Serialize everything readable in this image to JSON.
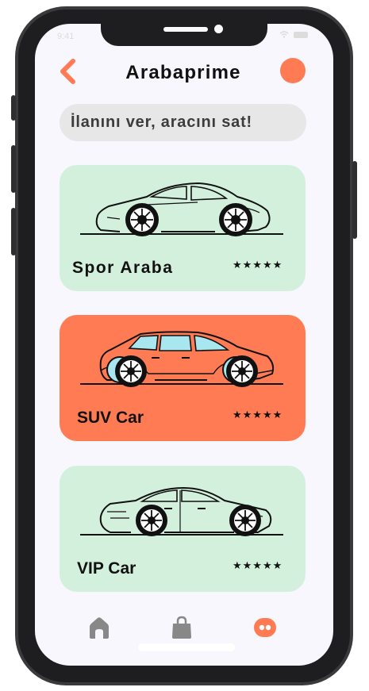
{
  "status_bar": {
    "time": "9:41"
  },
  "header": {
    "title": "Arabaprime"
  },
  "search": {
    "placeholder": "İlanını ver, aracını sat!"
  },
  "cards": [
    {
      "name": "Spor Araba",
      "rating": "★★★★★",
      "icon": "sports-car-icon",
      "color": "#d3f0dd"
    },
    {
      "name": "SUV Car",
      "rating": "★★★★★",
      "icon": "suv-car-icon",
      "color": "#ff7b54"
    },
    {
      "name": "VIP Car",
      "rating": "★★★★★",
      "icon": "sedan-car-icon",
      "color": "#d3f0dd"
    }
  ],
  "bottom_nav": {
    "items": [
      {
        "icon": "home-icon",
        "active": false
      },
      {
        "icon": "shopping-bag-icon",
        "active": false
      },
      {
        "icon": "chat-bubble-icon",
        "active": true
      }
    ]
  },
  "colors": {
    "accent": "#ff7b54",
    "card_mint": "#d3f0dd",
    "background": "#f7f7fd",
    "inactive_icon": "#888888"
  }
}
